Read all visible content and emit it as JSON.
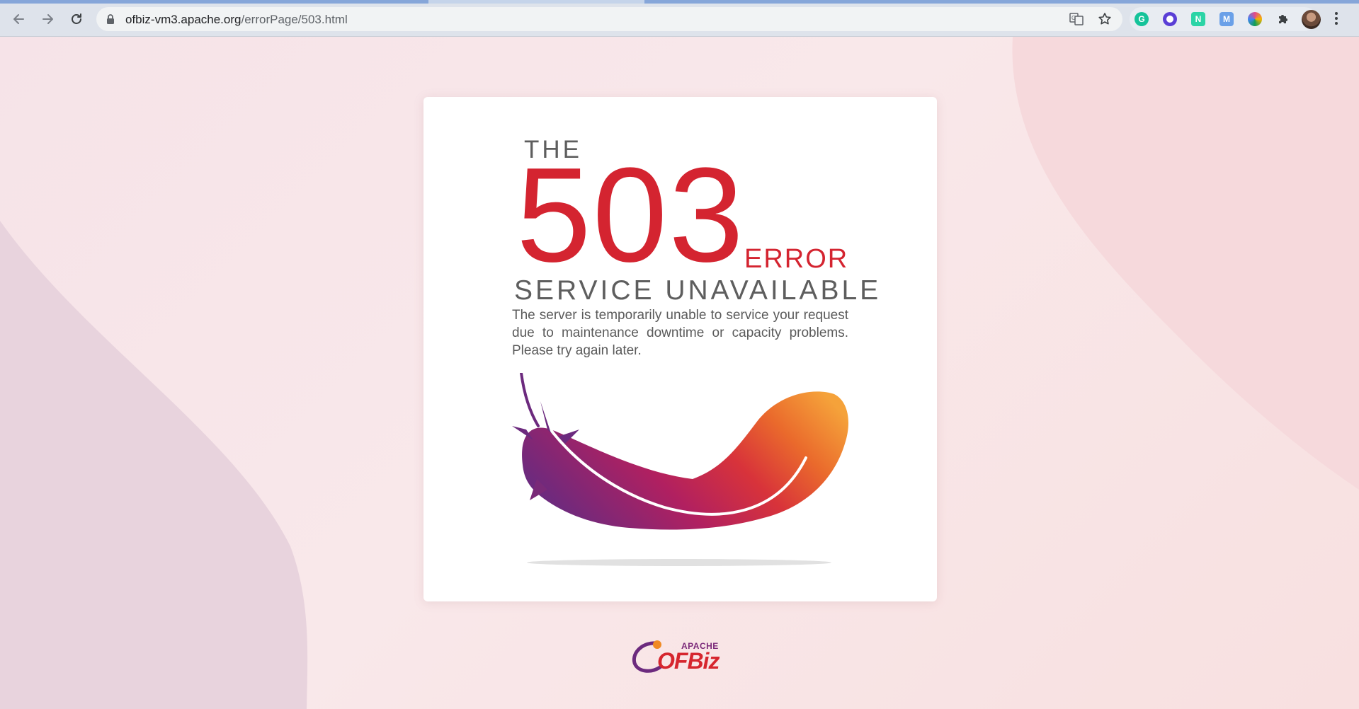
{
  "browser": {
    "url_host": "ofbiz-vm3.apache.org",
    "url_path": "/errorPage/503.html",
    "nav": {
      "back_icon": "arrow-left-icon",
      "forward_icon": "arrow-right-icon",
      "reload_icon": "reload-icon"
    },
    "omnibox_icons": [
      "lock-icon",
      "translate-icon",
      "star-icon"
    ],
    "extensions": [
      {
        "name": "grammarly-icon",
        "letter": "G",
        "color": "#15c39a"
      },
      {
        "name": "screen-recorder-icon",
        "letter": "",
        "color": "#5a3fd6"
      },
      {
        "name": "notion-like-icon",
        "letter": "N",
        "color": "#2bd4a6"
      },
      {
        "name": "mail-icon",
        "letter": "M",
        "color": "#6aa0e8"
      },
      {
        "name": "color-wheel-icon",
        "letter": "",
        "color": "#e34a8a"
      },
      {
        "name": "puzzle-icon",
        "letter": "",
        "color": "#3c4043"
      }
    ],
    "menu_icon": "three-dots-icon"
  },
  "error": {
    "prefix": "THE",
    "code": "503",
    "word": "ERROR",
    "title": "SERVICE UNAVAILABLE",
    "message": "The server is temporarily unable to service your request due to maintenance downtime or capacity problems. Please try again later."
  },
  "colors": {
    "accent_red": "#d42430",
    "text_gray": "#5e5e5e",
    "background": "#f8e5e8"
  },
  "footer": {
    "logo_top": "APACHE",
    "logo_main": "OFBiz"
  }
}
